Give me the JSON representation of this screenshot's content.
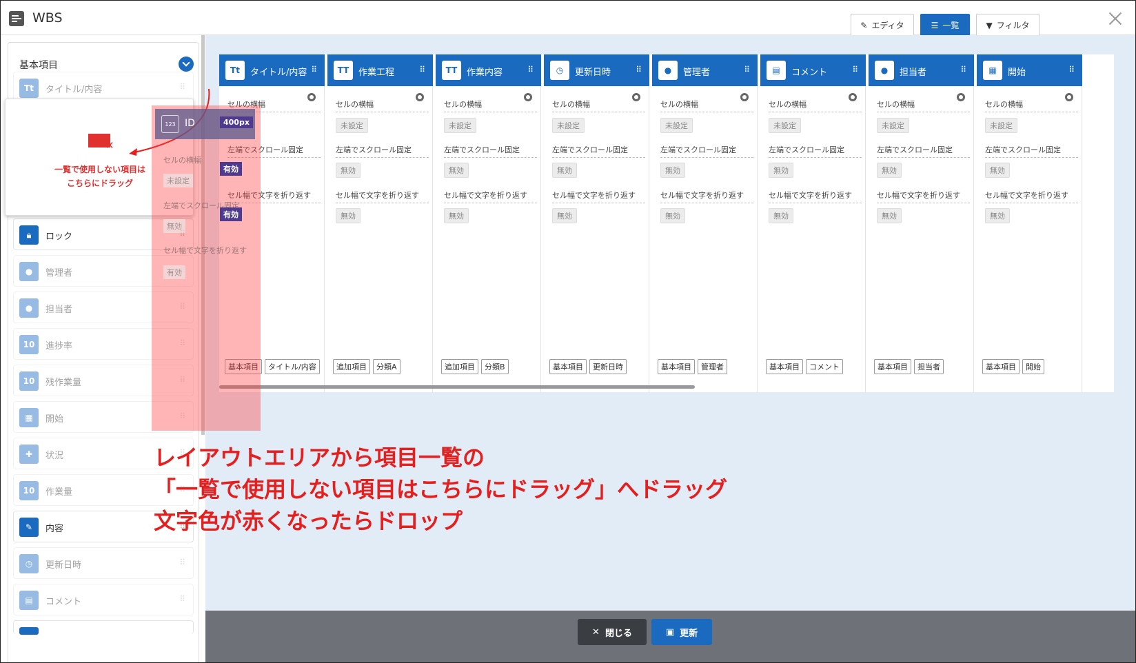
{
  "window": {
    "title": "WBS"
  },
  "view_tabs": [
    {
      "label": "エディタ",
      "icon": "edit-icon"
    },
    {
      "label": "一覧",
      "icon": "list-icon",
      "active": true
    },
    {
      "label": "フィルタ",
      "icon": "filter-icon"
    }
  ],
  "sidebar": {
    "header": "基本項目",
    "items": [
      {
        "label": "タイトル/内容",
        "icon": "Tt"
      },
      {
        "label": "ロック",
        "icon": "lock"
      },
      {
        "label": "管理者",
        "icon": "person"
      },
      {
        "label": "担当者",
        "icon": "person"
      },
      {
        "label": "進捗率",
        "icon": "123"
      },
      {
        "label": "残作業量",
        "icon": "123"
      },
      {
        "label": "開始",
        "icon": "calendar"
      },
      {
        "label": "状況",
        "icon": "status"
      },
      {
        "label": "作業量",
        "icon": "123"
      },
      {
        "label": "内容",
        "icon": "edit"
      },
      {
        "label": "更新日時",
        "icon": "clock"
      },
      {
        "label": "コメント",
        "icon": "comment"
      }
    ]
  },
  "dropzone": {
    "line1": "一覧で使用しない項目は",
    "line2": "こちらにドラッグ"
  },
  "ghost": {
    "title": "ID",
    "icon": "123",
    "width_label": "セルの横幅",
    "width_value": "400px",
    "width_unset": "未設定",
    "fix_label": "左端でスクロール固定",
    "fix_value": "有効",
    "fix_off": "無効",
    "wrap_label": "セル幅で文字を折り返す",
    "wrap_value": "有効",
    "wrap_off": "有効"
  },
  "columns": [
    {
      "title": "タイトル/内容",
      "icon": "Tt",
      "width": "未設定",
      "fix": "無効",
      "wrap": "無効",
      "tags": [
        "基本項目",
        "タイトル/内容"
      ]
    },
    {
      "title": "作業工程",
      "icon": "TT",
      "width": "未設定",
      "fix": "無効",
      "wrap": "無効",
      "tags": [
        "追加項目",
        "分類A"
      ]
    },
    {
      "title": "作業内容",
      "icon": "TT",
      "width": "未設定",
      "fix": "無効",
      "wrap": "無効",
      "tags": [
        "追加項目",
        "分類B"
      ]
    },
    {
      "title": "更新日時",
      "icon": "clock",
      "width": "未設定",
      "fix": "無効",
      "wrap": "無効",
      "tags": [
        "基本項目",
        "更新日時"
      ]
    },
    {
      "title": "管理者",
      "icon": "person",
      "width": "未設定",
      "fix": "無効",
      "wrap": "無効",
      "tags": [
        "基本項目",
        "管理者"
      ]
    },
    {
      "title": "コメント",
      "icon": "comment",
      "width": "未設定",
      "fix": "無効",
      "wrap": "無効",
      "tags": [
        "基本項目",
        "コメント"
      ]
    },
    {
      "title": "担当者",
      "icon": "person",
      "width": "未設定",
      "fix": "無効",
      "wrap": "無効",
      "tags": [
        "基本項目",
        "担当者"
      ]
    },
    {
      "title": "開始",
      "icon": "calendar",
      "width": "未設定",
      "fix": "無効",
      "wrap": "無効",
      "tags": [
        "基本項目",
        "開始"
      ]
    }
  ],
  "prop_labels": {
    "width": "セルの横幅",
    "fix": "左端でスクロール固定",
    "wrap": "セル幅で文字を折り返す"
  },
  "footer": {
    "close_label": "閉じる",
    "update_label": "更新"
  },
  "annotation": {
    "line1": "レイアウトエリアから項目一覧の",
    "line2": "「一覧で使用しない項目はこちらにドラッグ」へドラッグ",
    "line3": "文字色が赤くなったらドロップ"
  },
  "colors": {
    "accent": "#1a6bbf",
    "highlight": "#e51e1e",
    "badge": "#4e3a8e"
  }
}
